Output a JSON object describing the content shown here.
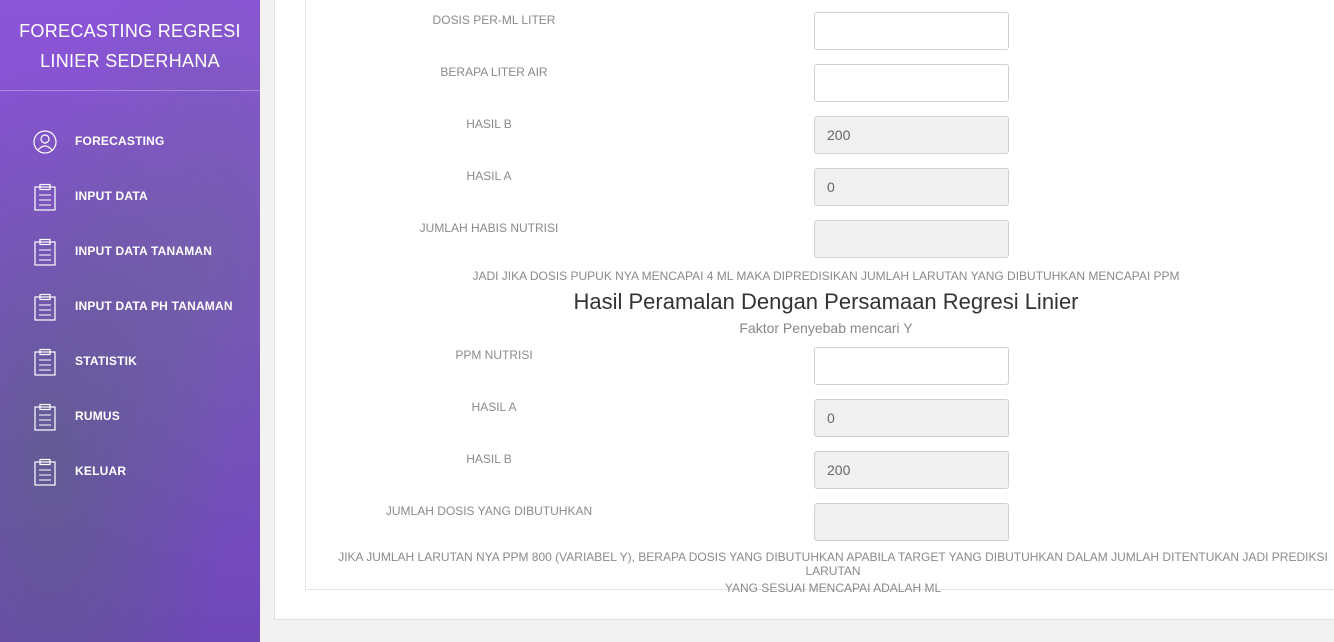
{
  "sidebar": {
    "brand_line1": "FORECASTING REGRESI",
    "brand_line2": "LINIER SEDERHANA",
    "items": [
      {
        "label": "FORECASTING",
        "icon": "user-circle-icon"
      },
      {
        "label": "INPUT DATA",
        "icon": "clipboard-icon"
      },
      {
        "label": "INPUT DATA TANAMAN",
        "icon": "clipboard-icon"
      },
      {
        "label": "INPUT DATA PH TANAMAN",
        "icon": "clipboard-icon"
      },
      {
        "label": "STATISTIK",
        "icon": "clipboard-icon"
      },
      {
        "label": "RUMUS",
        "icon": "clipboard-icon"
      },
      {
        "label": "KELUAR",
        "icon": "clipboard-icon"
      }
    ]
  },
  "form1": {
    "dosis_label": "DOSIS PER-ML LITER",
    "dosis_value": "",
    "liter_label": "BERAPA LITER AIR",
    "liter_value": "",
    "hasil_b_label": "HASIL B",
    "hasil_b_value": "200",
    "hasil_a_label": "HASIL A",
    "hasil_a_value": "0",
    "jumlah_label": "JUMLAH HABIS NUTRISI",
    "jumlah_value": "",
    "note": "JADI JIKA DOSIS PUPUK NYA MENCAPAI 4 ML MAKA DIPREDISIKAN JUMLAH LARUTAN YANG DIBUTUHKAN MENCAPAI PPM"
  },
  "section2": {
    "heading": "Hasil Peramalan Dengan Persamaan Regresi Linier",
    "subheading": "Faktor Penyebab mencari Y"
  },
  "form2": {
    "ppm_label": "PPM NUTRISI",
    "ppm_value": "",
    "hasil_a_label": "HASIL A",
    "hasil_a_value": "0",
    "hasil_b_label": "HASIL B",
    "hasil_b_value": "200",
    "jumlah_label": "JUMLAH DOSIS YANG DIBUTUHKAN",
    "jumlah_value": "",
    "note_line1": "JIKA JUMLAH LARUTAN NYA PPM 800 (VARIABEL Y), BERAPA DOSIS YANG DIBUTUHKAN APABILA TARGET YANG DIBUTUHKAN DALAM JUMLAH DITENTUKAN JADI PREDIKSI LARUTAN",
    "note_line2": "YANG SESUAI MENCAPAI ADALAH ML"
  },
  "colors": {
    "sidebar": "#7d4fc9",
    "input_readonly": "#f0f0f0"
  }
}
